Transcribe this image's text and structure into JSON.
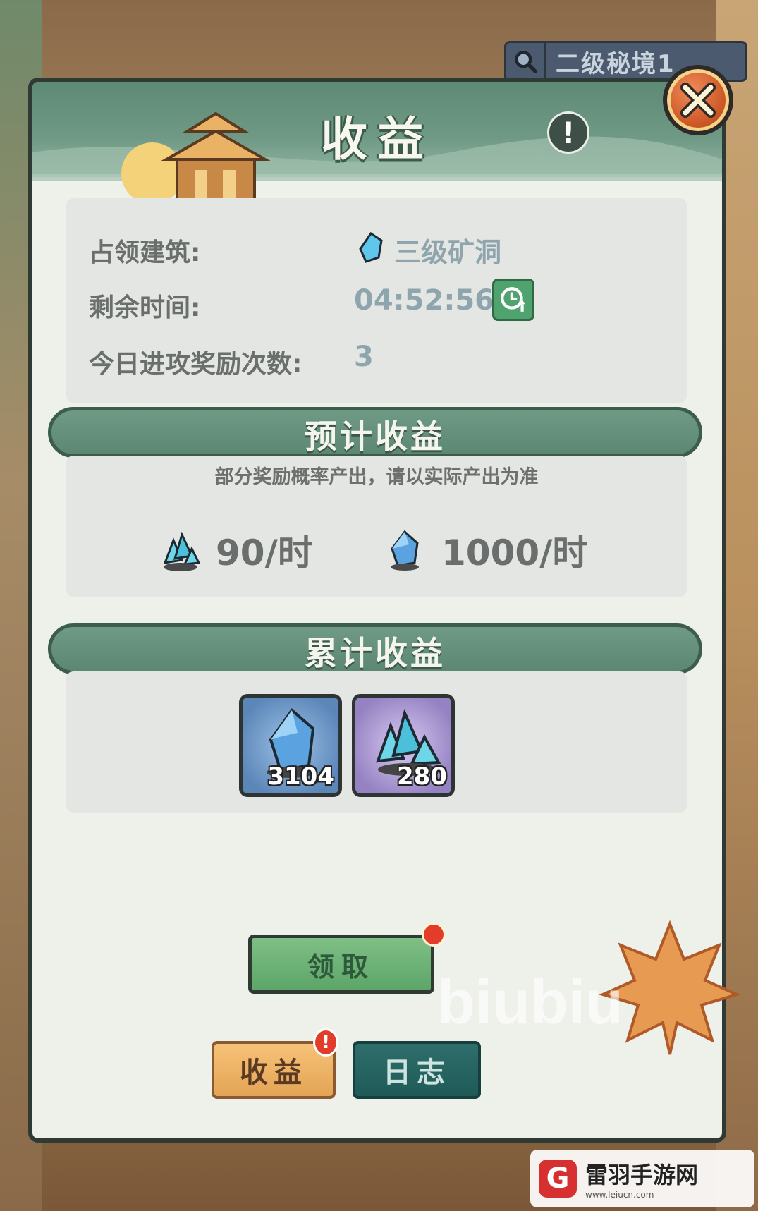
{
  "search": {
    "text": "二级秘境1"
  },
  "panel": {
    "title": "收益",
    "info_icon": "!",
    "info": {
      "building_label": "占领建筑:",
      "building_value": "三级矿洞",
      "time_label": "剩余时间:",
      "time_value": "04:52:56",
      "attack_label": "今日进攻奖励次数:",
      "attack_value": "3"
    },
    "expected": {
      "title": "预计收益",
      "note": "部分奖励概率产出，请以实际产出为准",
      "rates": [
        {
          "icon": "crystal-cluster-icon",
          "value": "90/时"
        },
        {
          "icon": "crystal-gem-icon",
          "value": "1000/时"
        }
      ]
    },
    "accumulated": {
      "title": "累计收益",
      "items": [
        {
          "icon": "crystal-gem-icon",
          "count": "3104",
          "frame": "blue"
        },
        {
          "icon": "crystal-cluster-icon",
          "count": "280",
          "frame": "purple"
        }
      ]
    },
    "claim_button": "领取"
  },
  "tabs": [
    {
      "label": "收益",
      "badge": "!"
    },
    {
      "label": "日志"
    }
  ],
  "watermark": "biubiu",
  "site": {
    "name": "雷羽手游网",
    "url": "www.leiucn.com"
  },
  "colors": {
    "header_green": "#5e8a75",
    "accent_red": "#e23c2a",
    "gem_blue": "#5fc6ec"
  }
}
